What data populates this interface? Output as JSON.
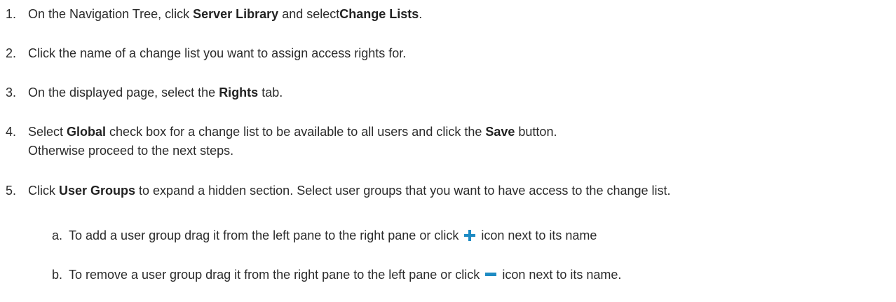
{
  "steps": [
    {
      "num": "1.",
      "t1": "On the Navigation Tree, click ",
      "b1": "Server Library",
      "t2": " and select",
      "b2": "Change Lists",
      "t3": "."
    },
    {
      "num": "2.",
      "t1": "Click the name of a change list you want to assign access rights for."
    },
    {
      "num": "3.",
      "t1": "On the displayed page, select the ",
      "b1": "Rights",
      "t2": " tab."
    },
    {
      "num": "4.",
      "t1": "Select ",
      "b1": "Global",
      "t2": " check box for a change list to be available to all users and click the ",
      "b2": "Save",
      "t3": " button.",
      "cont": "Otherwise proceed to the next steps."
    },
    {
      "num": "5.",
      "t1": "Click ",
      "b1": "User Groups",
      "t2": " to expand a hidden section. Select user groups that you want to have access to the change list."
    }
  ],
  "substeps": [
    {
      "letter": "a.",
      "t1": "To add a user group drag it from the left pane to the right pane or click ",
      "icon": "plus-icon",
      "t2": " icon next to its name"
    },
    {
      "letter": "b.",
      "t1": "To remove a user group drag it from the right pane to the left  pane or click ",
      "icon": "minus-icon",
      "t2": " icon next to its name."
    }
  ],
  "colors": {
    "icon": "#1e8bc3",
    "text": "#2b2b2b"
  }
}
